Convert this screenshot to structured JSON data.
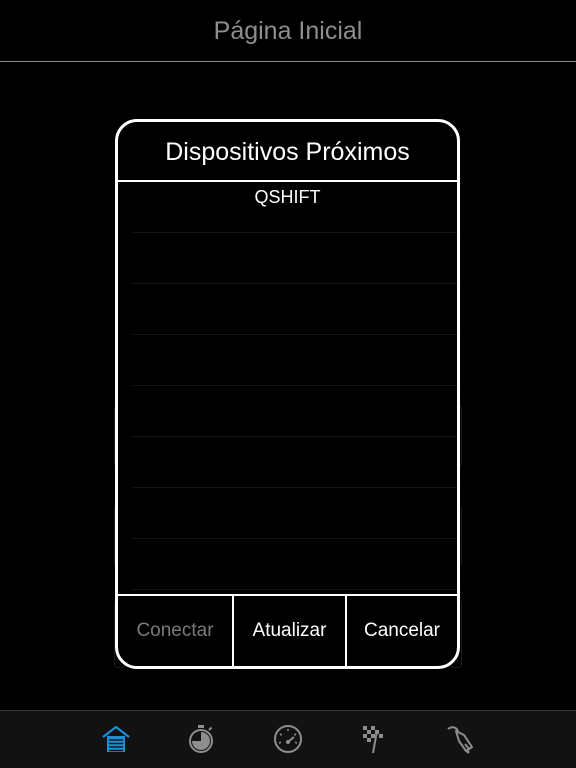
{
  "header": {
    "title": "Página Inicial"
  },
  "modal": {
    "title": "Dispositivos Próximos",
    "devices": [
      {
        "name": "QSHIFT"
      },
      {
        "name": ""
      },
      {
        "name": ""
      },
      {
        "name": ""
      },
      {
        "name": ""
      },
      {
        "name": ""
      },
      {
        "name": ""
      },
      {
        "name": ""
      }
    ],
    "buttons": {
      "connect": "Conectar",
      "refresh": "Atualizar",
      "cancel": "Cancelar"
    }
  },
  "tabs": [
    {
      "icon": "garage-home-icon",
      "active": true
    },
    {
      "icon": "stopwatch-icon",
      "active": false
    },
    {
      "icon": "speedometer-icon",
      "active": false
    },
    {
      "icon": "checkered-flag-icon",
      "active": false
    },
    {
      "icon": "fuel-nozzle-icon",
      "active": false
    }
  ],
  "colors": {
    "active_tab": "#1a8fd6",
    "inactive_tab": "#8e8e8e",
    "disabled_text": "#7a7a7a"
  }
}
